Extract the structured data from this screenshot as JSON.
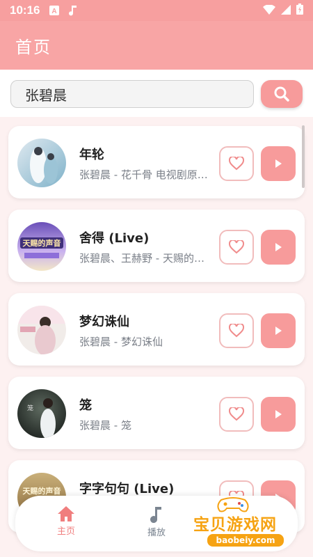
{
  "status_bar": {
    "time": "10:16",
    "notification_icons": [
      "a-icon",
      "music-note-icon"
    ]
  },
  "app_bar": {
    "title": "首页"
  },
  "search": {
    "value": "张碧晨"
  },
  "songs": [
    {
      "title": "年轮",
      "subtitle": "张碧晨 - 花千骨 电视剧原声带"
    },
    {
      "title": "舍得 (Live)",
      "subtitle": "张碧晨、王赫野 - 天赐的声音 第五季"
    },
    {
      "title": "梦幻诛仙",
      "subtitle": "张碧晨 - 梦幻诛仙"
    },
    {
      "title": "笼",
      "subtitle": "张碧晨 - 笼"
    },
    {
      "title": "字字句句 (Live)",
      "subtitle": ""
    }
  ],
  "bottom_nav": {
    "items": [
      {
        "label": "主页",
        "icon": "home-icon",
        "active": true
      },
      {
        "label": "播放",
        "icon": "music-note-icon",
        "active": false
      }
    ]
  },
  "watermark": {
    "text": "宝贝游戏网",
    "url": "baobeiy.com"
  },
  "colors": {
    "accent": "#f79b9b",
    "app_bar": "#f8a5a5",
    "active_nav": "#f07e7e",
    "inactive_nav": "#7b8591"
  }
}
